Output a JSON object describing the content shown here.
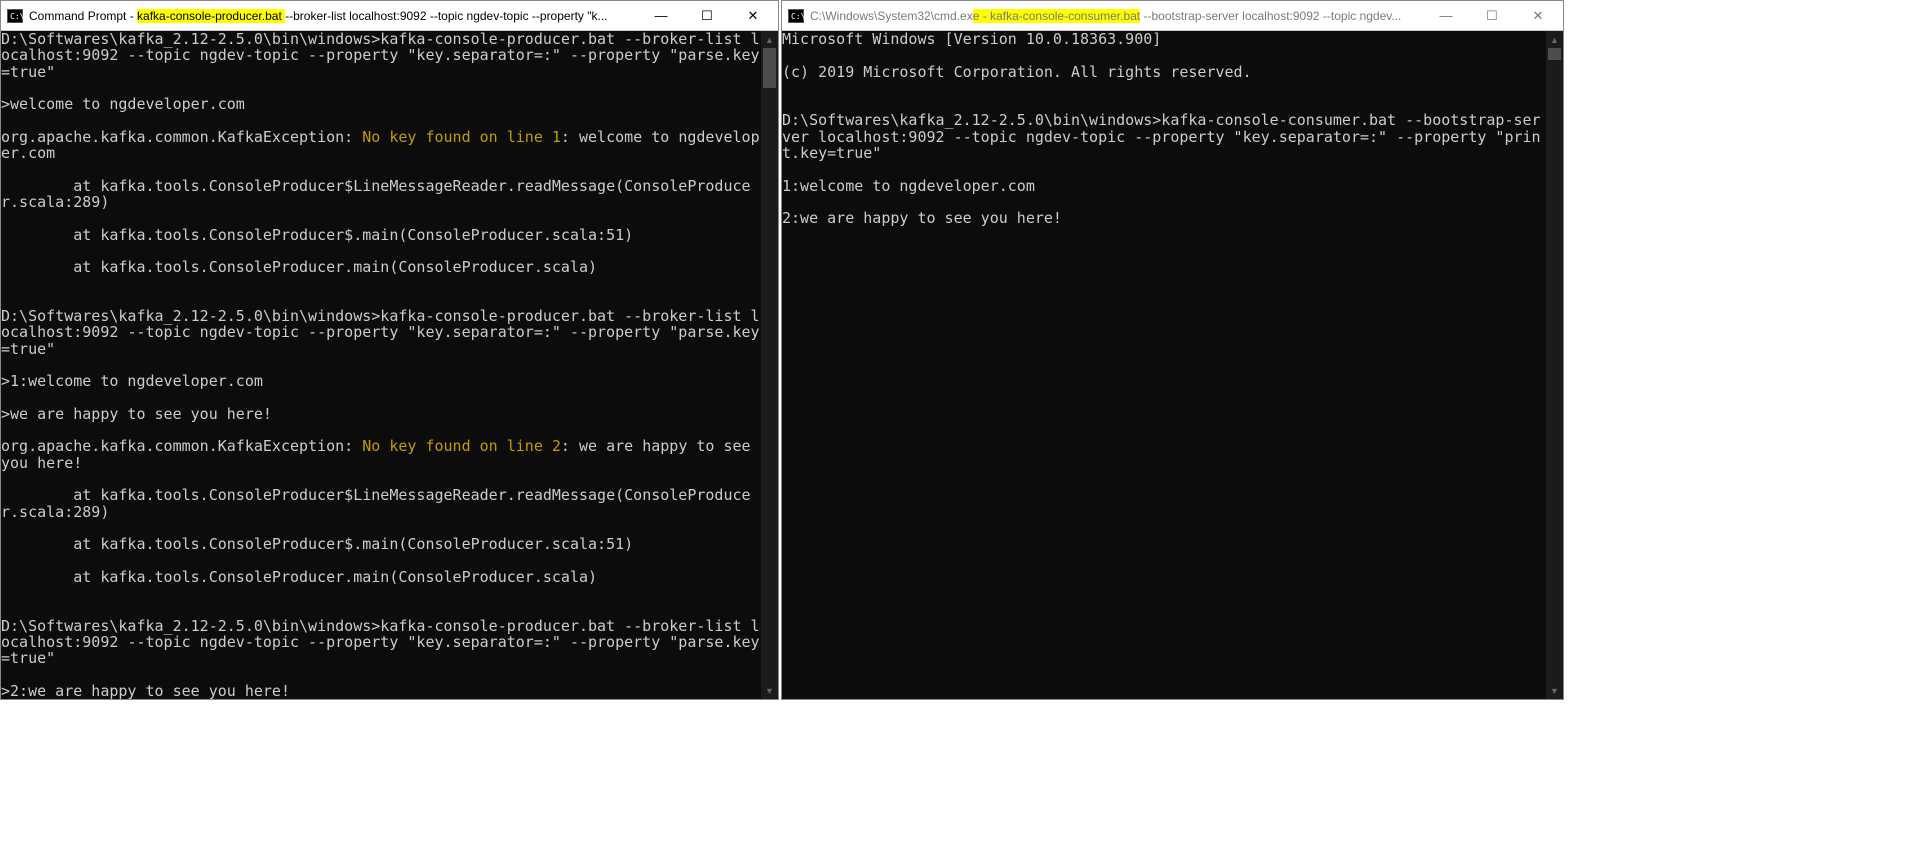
{
  "left_window": {
    "title_pre": "Command Prompt - ",
    "title_hl": "kafka-console-producer.bat ",
    "title_post": "--broker-list localhost:9092 --topic ngdev-topic --property \"k...",
    "icon_text": "C:\\",
    "min": "—",
    "max": "☐",
    "close": "✕",
    "lines": [
      {
        "t": "D:\\Softwares\\kafka_2.12-2.5.0\\bin\\windows>kafka-console-producer.bat --broker-list localhost:9092 --topic ngdev-topic --property \"key.separator=:\" --property \"parse.key=true\""
      },
      {
        "t": ">welcome to ngdeveloper.com"
      },
      {
        "pre": "org.apache.kafka.common.KafkaException: ",
        "hl": "No key found on line 1",
        "post": ": welcome to ngdeveloper.com"
      },
      {
        "t": "        at kafka.tools.ConsoleProducer$LineMessageReader.readMessage(ConsoleProducer.scala:289)"
      },
      {
        "t": "        at kafka.tools.ConsoleProducer$.main(ConsoleProducer.scala:51)"
      },
      {
        "t": "        at kafka.tools.ConsoleProducer.main(ConsoleProducer.scala)"
      },
      {
        "t": ""
      },
      {
        "t": "D:\\Softwares\\kafka_2.12-2.5.0\\bin\\windows>kafka-console-producer.bat --broker-list localhost:9092 --topic ngdev-topic --property \"key.separator=:\" --property \"parse.key=true\""
      },
      {
        "t": ">1:welcome to ngdeveloper.com"
      },
      {
        "t": ">we are happy to see you here!"
      },
      {
        "pre": "org.apache.kafka.common.KafkaException: ",
        "hl": "No key found on line 2",
        "post": ": we are happy to see you here!"
      },
      {
        "t": "        at kafka.tools.ConsoleProducer$LineMessageReader.readMessage(ConsoleProducer.scala:289)"
      },
      {
        "t": "        at kafka.tools.ConsoleProducer$.main(ConsoleProducer.scala:51)"
      },
      {
        "t": "        at kafka.tools.ConsoleProducer.main(ConsoleProducer.scala)"
      },
      {
        "t": ""
      },
      {
        "t": "D:\\Softwares\\kafka_2.12-2.5.0\\bin\\windows>kafka-console-producer.bat --broker-list localhost:9092 --topic ngdev-topic --property \"key.separator=:\" --property \"parse.key=true\""
      },
      {
        "t": ">2:we are happy to see you here!"
      },
      {
        "t": ">"
      }
    ]
  },
  "right_window": {
    "title_pre": "C:\\Windows\\System32\\cmd.ex",
    "title_hl": "e - kafka-console-consumer.bat",
    "title_post": "  --bootstrap-server localhost:9092 --topic ngdev...",
    "icon_text": "C:\\",
    "min": "—",
    "max": "☐",
    "close": "✕",
    "lines": [
      {
        "t": "Microsoft Windows [Version 10.0.18363.900]"
      },
      {
        "t": "(c) 2019 Microsoft Corporation. All rights reserved."
      },
      {
        "t": ""
      },
      {
        "t": "D:\\Softwares\\kafka_2.12-2.5.0\\bin\\windows>kafka-console-consumer.bat --bootstrap-server localhost:9092 --topic ngdev-topic --property \"key.separator=:\" --property \"print.key=true\""
      },
      {
        "t": "1:welcome to ngdeveloper.com"
      },
      {
        "t": "2:we are happy to see you here!"
      }
    ]
  }
}
